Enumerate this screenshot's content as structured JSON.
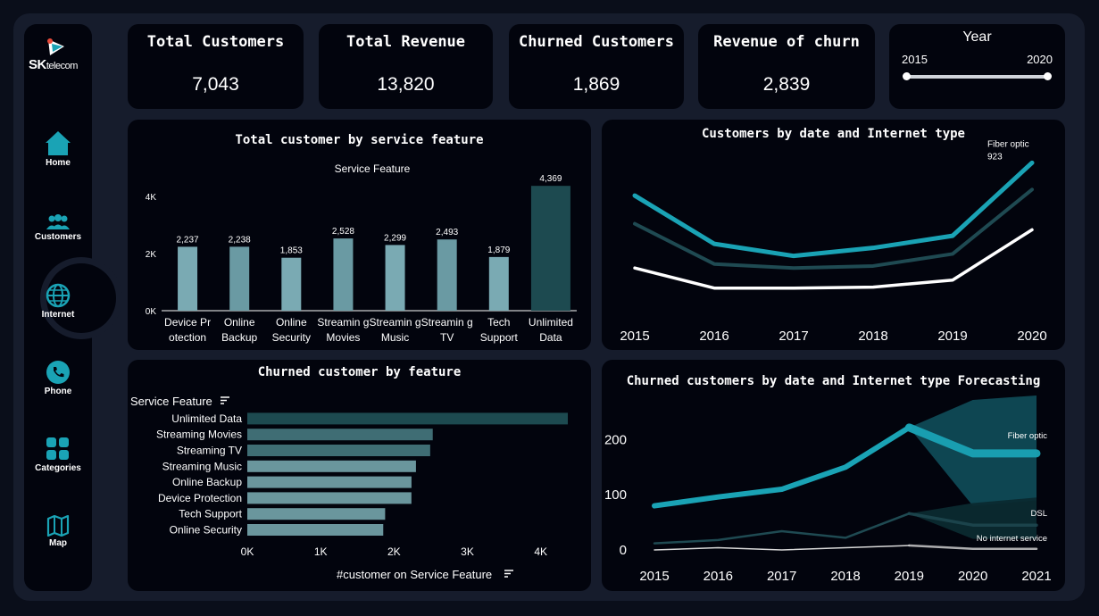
{
  "brand": {
    "name_sk": "SK",
    "name_rest": "telecom"
  },
  "nav": [
    {
      "label": "Home",
      "icon": "home-icon"
    },
    {
      "label": "Customers",
      "icon": "users-icon"
    },
    {
      "label": "Internet",
      "icon": "globe-icon",
      "active": true
    },
    {
      "label": "Phone",
      "icon": "phone-icon"
    },
    {
      "label": "Categories",
      "icon": "grid-icon"
    },
    {
      "label": "Map",
      "icon": "map-icon"
    }
  ],
  "kpis": [
    {
      "title": "Total Customers",
      "value": "7,043"
    },
    {
      "title": "Total Revenue",
      "value": "13,820"
    },
    {
      "title": "Churned Customers",
      "value": "1,869"
    },
    {
      "title": "Revenue of churn",
      "value": "2,839"
    }
  ],
  "year_filter": {
    "title": "Year",
    "min": "2015",
    "max": "2020",
    "selected_from": 2015,
    "selected_to": 2020
  },
  "colors": {
    "accent": "#1aa3b5",
    "teal_dark": "#1e4a51",
    "bar_light": "#7aaab3",
    "panel_bg": "#02040d",
    "frame_bg": "#161c2c"
  },
  "chart_data": [
    {
      "type": "bar",
      "title": "Total customer by service feature",
      "subtitle": "Service Feature",
      "categories": [
        "Device Pr otection",
        "Online Backup",
        "Online Security",
        "Streamin g Movies",
        "Streamin g Music",
        "Streamin g TV",
        "Tech Support",
        "Unlimited Data"
      ],
      "values": [
        2237,
        2238,
        1853,
        2528,
        2299,
        2493,
        1879,
        4369
      ],
      "value_labels": [
        "2,237",
        "2,238",
        "1,853",
        "2,528",
        "2,299",
        "2,493",
        "1,879",
        "4,369"
      ],
      "ylim": [
        0,
        4500
      ],
      "yticks": [
        "0K",
        "2K",
        "4K"
      ],
      "ytick_values": [
        0,
        2000,
        4000
      ]
    },
    {
      "type": "line",
      "title": "Customers by date and Internet type",
      "x": [
        "2015",
        "2016",
        "2017",
        "2018",
        "2019",
        "2020"
      ],
      "series": [
        {
          "name": "Fiber optic",
          "values": [
            760,
            520,
            460,
            500,
            560,
            923
          ],
          "color": "#1aa3b5"
        },
        {
          "values": [
            620,
            420,
            400,
            410,
            470,
            790
          ],
          "color": "#1f4a52"
        },
        {
          "values": [
            400,
            300,
            300,
            305,
            340,
            590
          ],
          "color": "#ffffff"
        }
      ],
      "annotation": {
        "series": "Fiber optic",
        "value": "923"
      },
      "ylim": [
        250,
        960
      ]
    },
    {
      "type": "bar",
      "orientation": "horizontal",
      "title": "Churned customer by  feature",
      "ylabel": "Service Feature",
      "xlabel": "#customer on Service Feature",
      "categories": [
        "Unlimited Data",
        "Streaming Movies",
        "Streaming TV",
        "Streaming Music",
        "Online Backup",
        "Device Protection",
        "Tech Support",
        "Online Security"
      ],
      "values": [
        4369,
        2528,
        2493,
        2299,
        2238,
        2237,
        1879,
        1853
      ],
      "xlim": [
        0,
        4600
      ],
      "xticks": [
        "0K",
        "1K",
        "2K",
        "3K",
        "4K"
      ],
      "xtick_values": [
        0,
        1000,
        2000,
        3000,
        4000
      ]
    },
    {
      "type": "line",
      "title": "Churned customers by date and Internet type Forecasting",
      "x": [
        "2015",
        "2016",
        "2017",
        "2018",
        "2019",
        "2020",
        "2021"
      ],
      "series": [
        {
          "name": "Fiber optic",
          "values": [
            80,
            96,
            110,
            150,
            222,
            175,
            175
          ],
          "color": "#1aa3b5"
        },
        {
          "name": "DSL",
          "values": [
            12,
            18,
            34,
            22,
            66,
            45,
            45
          ],
          "color": "#1f4a52"
        },
        {
          "name": "No internet service",
          "values": [
            0,
            4,
            0,
            4,
            8,
            2,
            2
          ],
          "color": "#d8d8d8"
        }
      ],
      "forecast_from": "2019",
      "forecast_bands": [
        {
          "series": "Fiber optic",
          "upper": [
            222,
            272,
            280
          ],
          "lower": [
            222,
            80,
            90
          ]
        },
        {
          "series": "DSL",
          "upper": [
            66,
            85,
            95
          ],
          "lower": [
            66,
            20,
            20
          ]
        }
      ],
      "ylim": [
        0,
        280
      ],
      "yticks": [
        "0",
        "100",
        "200"
      ],
      "ytick_values": [
        0,
        100,
        200
      ]
    }
  ]
}
